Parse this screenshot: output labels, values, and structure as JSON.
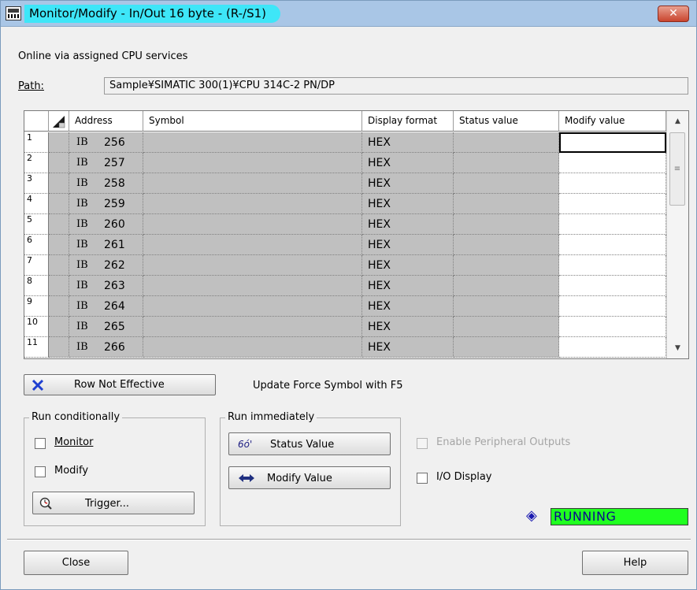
{
  "window": {
    "title": "Monitor/Modify - In/Out  16 byte - (R-/S1)",
    "close_glyph": "✕"
  },
  "online_text": "Online via assigned CPU services",
  "path": {
    "label": "Path:",
    "value": "Sample¥SIMATIC 300(1)¥CPU 314C-2 PN/DP"
  },
  "table": {
    "headers": {
      "address": "Address",
      "symbol": "Symbol",
      "display_format": "Display format",
      "status_value": "Status value",
      "modify_value": "Modify value"
    },
    "rows": [
      {
        "num": "1",
        "area": "IB",
        "addr": "256",
        "fmt": "HEX"
      },
      {
        "num": "2",
        "area": "IB",
        "addr": "257",
        "fmt": "HEX"
      },
      {
        "num": "3",
        "area": "IB",
        "addr": "258",
        "fmt": "HEX"
      },
      {
        "num": "4",
        "area": "IB",
        "addr": "259",
        "fmt": "HEX"
      },
      {
        "num": "5",
        "area": "IB",
        "addr": "260",
        "fmt": "HEX"
      },
      {
        "num": "6",
        "area": "IB",
        "addr": "261",
        "fmt": "HEX"
      },
      {
        "num": "7",
        "area": "IB",
        "addr": "262",
        "fmt": "HEX"
      },
      {
        "num": "8",
        "area": "IB",
        "addr": "263",
        "fmt": "HEX"
      },
      {
        "num": "9",
        "area": "IB",
        "addr": "264",
        "fmt": "HEX"
      },
      {
        "num": "10",
        "area": "IB",
        "addr": "265",
        "fmt": "HEX"
      },
      {
        "num": "11",
        "area": "IB",
        "addr": "266",
        "fmt": "HEX"
      }
    ]
  },
  "row_not_effective": {
    "label": "Row Not Effective",
    "icon": "blue-x-icon"
  },
  "update_force_text": "Update Force Symbol with F5",
  "run_conditionally": {
    "title": "Run conditionally",
    "monitor_label": "Monitor",
    "modify_label": "Modify",
    "trigger_label": "Trigger..."
  },
  "run_immediately": {
    "title": "Run immediately",
    "status_value_label": "Status Value",
    "modify_value_label": "Modify Value"
  },
  "enable_peripheral_outputs_label": "Enable Peripheral Outputs",
  "io_display_label": "I/O Display",
  "status": {
    "text": "RUNNING",
    "color": "#20ff20"
  },
  "footer": {
    "close_label": "Close",
    "help_label": "Help"
  },
  "colors": {
    "title_highlight": "#3ee6f8",
    "grid_locked": "#c0c0c0"
  }
}
